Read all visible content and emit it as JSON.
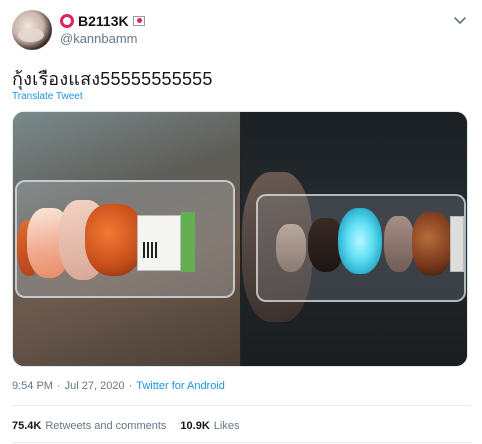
{
  "author": {
    "display_name": "B2113K",
    "handle": "@kannbamm",
    "avatar_icon": "avatar-photo",
    "name_prefix_icon": "red-circle-icon",
    "name_suffix_icon": "flag-badge-icon"
  },
  "tweet": {
    "text": "กุ้งเรืองแสง55555555555",
    "translate_label": "Translate Tweet"
  },
  "meta": {
    "time": "9:54 PM",
    "separator1": "·",
    "date": "Jul 27, 2020",
    "separator2": "·",
    "source": "Twitter for Android"
  },
  "stats": {
    "retweets_count": "75.4K",
    "retweets_label": "Retweets and comments",
    "likes_count": "10.9K",
    "likes_label": "Likes"
  },
  "colors": {
    "link": "#1b95e0",
    "muted": "#657786",
    "accent_red": "#e0245e",
    "glow": "#61e0f5"
  }
}
